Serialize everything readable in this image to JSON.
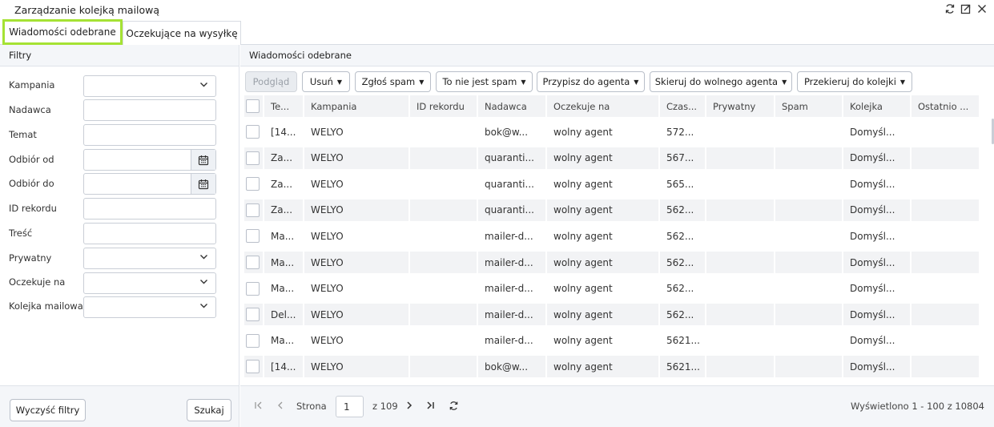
{
  "window": {
    "title": "Zarządzanie kolejką mailową"
  },
  "tabs": [
    {
      "label": "Wiadomości odebrane",
      "active": true
    },
    {
      "label": "Oczekujące na wysyłkę",
      "active": false
    }
  ],
  "filters": {
    "header": "Filtry",
    "fields": [
      {
        "label": "Kampania",
        "type": "select",
        "value": ""
      },
      {
        "label": "Nadawca",
        "type": "text",
        "value": ""
      },
      {
        "label": "Temat",
        "type": "text",
        "value": ""
      },
      {
        "label": "Odbiór od",
        "type": "date",
        "value": ""
      },
      {
        "label": "Odbiór do",
        "type": "date",
        "value": ""
      },
      {
        "label": "ID rekordu",
        "type": "text",
        "value": ""
      },
      {
        "label": "Treść",
        "type": "text",
        "value": ""
      },
      {
        "label": "Prywatny",
        "type": "select",
        "value": ""
      },
      {
        "label": "Oczekuje na",
        "type": "select",
        "value": ""
      },
      {
        "label": "Kolejka mailowa",
        "type": "select",
        "value": ""
      }
    ],
    "clear_label": "Wyczyść filtry",
    "search_label": "Szukaj"
  },
  "main": {
    "header": "Wiadomości odebrane",
    "toolbar": {
      "preview": "Podgląd",
      "delete": "Usuń",
      "report_spam": "Zgłoś spam",
      "not_spam": "To nie jest spam",
      "assign_agent": "Przypisz do agenta",
      "free_agent": "Skieruj do wolnego agenta",
      "redirect_queue": "Przekieruj do kolejki"
    },
    "columns": [
      "Te...",
      "Kampania",
      "ID rekordu",
      "Nadawca",
      "Oczekuje na",
      "Czas...",
      "Prywatny",
      "Spam",
      "Kolejka",
      "Ostatnio ..."
    ],
    "rows": [
      [
        "[14...",
        "WELYO",
        "",
        "bok@w...",
        "wolny agent",
        "572...",
        "",
        "",
        "Domyśl...",
        ""
      ],
      [
        "Za...",
        "WELYO",
        "",
        "quaranti...",
        "wolny agent",
        "567...",
        "",
        "",
        "Domyśl...",
        ""
      ],
      [
        "Za...",
        "WELYO",
        "",
        "quaranti...",
        "wolny agent",
        "565...",
        "",
        "",
        "Domyśl...",
        ""
      ],
      [
        "Za...",
        "WELYO",
        "",
        "quaranti...",
        "wolny agent",
        "562...",
        "",
        "",
        "Domyśl...",
        ""
      ],
      [
        "Ma...",
        "WELYO",
        "",
        "mailer-d...",
        "wolny agent",
        "562...",
        "",
        "",
        "Domyśl...",
        ""
      ],
      [
        "Ma...",
        "WELYO",
        "",
        "mailer-d...",
        "wolny agent",
        "562...",
        "",
        "",
        "Domyśl...",
        ""
      ],
      [
        "Ma...",
        "WELYO",
        "",
        "mailer-d...",
        "wolny agent",
        "562...",
        "",
        "",
        "Domyśl...",
        ""
      ],
      [
        "Del...",
        "WELYO",
        "",
        "mailer-d...",
        "wolny agent",
        "562...",
        "",
        "",
        "Domyśl...",
        ""
      ],
      [
        "Ma...",
        "WELYO",
        "",
        "mailer-d...",
        "wolny agent",
        "5621...",
        "",
        "",
        "Domyśl...",
        ""
      ],
      [
        "[14...",
        "WELYO",
        "",
        "bok@w...",
        "wolny agent",
        "5621...",
        "",
        "",
        "Domyśl...",
        ""
      ]
    ],
    "pager": {
      "page_label": "Strona",
      "page_value": "1",
      "of_label": "z 109",
      "summary": "Wyświetlono 1 - 100 z 10804"
    }
  }
}
